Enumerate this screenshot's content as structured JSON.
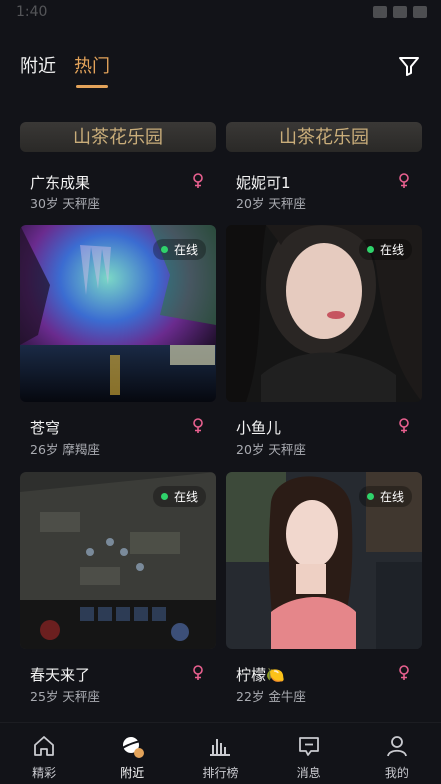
{
  "status_bar": {
    "time": "1:40"
  },
  "top_tabs": [
    {
      "label": "附近",
      "active": false
    },
    {
      "label": "热门",
      "active": true
    }
  ],
  "accent_color": "#e3a35a",
  "online_color": "#2fd36b",
  "gender_color": "#e8608f",
  "banner_text": "山茶花乐园",
  "cards": [
    {
      "name": "广东成果",
      "age_sign": "30岁 天秤座",
      "online": false
    },
    {
      "name": "妮妮可1",
      "age_sign": "20岁 天秤座",
      "online": false
    },
    {
      "name": "苍穹",
      "age_sign": "26岁 摩羯座",
      "online": true,
      "online_label": "在线"
    },
    {
      "name": "小鱼儿",
      "age_sign": "20岁 天秤座",
      "online": true,
      "online_label": "在线"
    },
    {
      "name": "春天来了",
      "age_sign": "25岁 天秤座",
      "online": true,
      "online_label": "在线"
    },
    {
      "name": "柠檬🍋",
      "age_sign": "22岁 金牛座",
      "online": true,
      "online_label": "在线"
    }
  ],
  "nav": [
    {
      "label": "精彩",
      "icon": "home-icon",
      "active": false
    },
    {
      "label": "附近",
      "icon": "planet-icon",
      "active": true
    },
    {
      "label": "排行榜",
      "icon": "bar-chart-icon",
      "active": false
    },
    {
      "label": "消息",
      "icon": "message-icon",
      "active": false
    },
    {
      "label": "我的",
      "icon": "user-icon",
      "active": false
    }
  ]
}
